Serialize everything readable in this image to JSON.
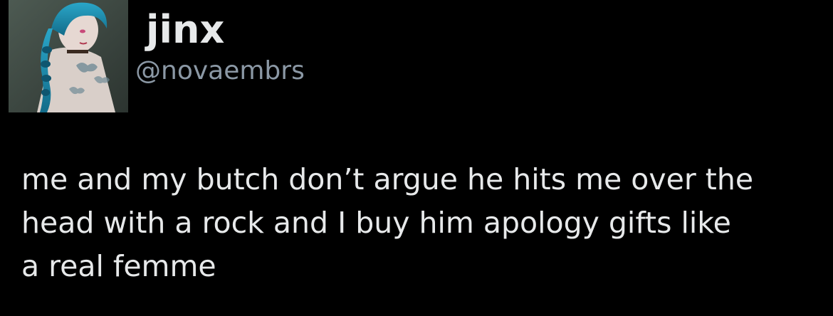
{
  "author": {
    "display_name": "jinx",
    "handle": "@novaembrs",
    "avatar_icon": "profile-avatar-image"
  },
  "tweet": {
    "lines": [
      "me and my butch don’t argue he hits me over the",
      "head with a rock and I buy him apology gifts like",
      "a real femme"
    ]
  },
  "colors": {
    "background": "#000000",
    "text": "#e7e9ea",
    "secondary_text": "#8b98a5"
  }
}
